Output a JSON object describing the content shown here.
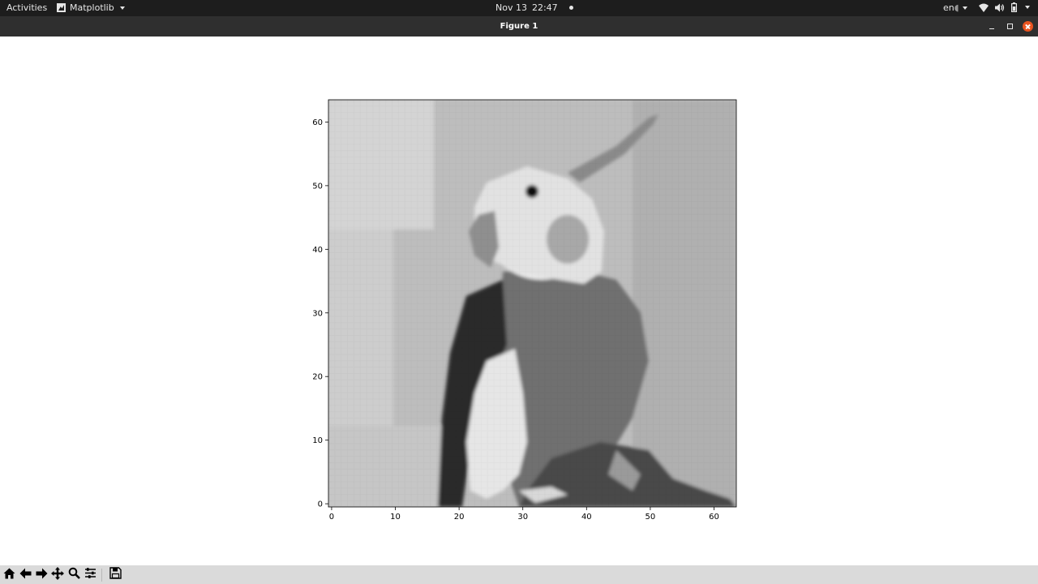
{
  "topbar": {
    "activities": "Activities",
    "app_name": "Matplotlib",
    "date": "Nov 13",
    "time": "22:47",
    "language": "en",
    "icons": [
      "wifi-icon",
      "volume-icon",
      "battery-icon",
      "power-menu-caret"
    ]
  },
  "window": {
    "title": "Figure 1",
    "controls": [
      "minimize",
      "maximize",
      "close"
    ],
    "close_color": "#e95420"
  },
  "toolbar": {
    "buttons": [
      "home-icon",
      "back-icon",
      "forward-icon",
      "pan-icon",
      "zoom-icon",
      "configure-subplots-icon",
      "save-icon"
    ]
  },
  "chart_data": {
    "type": "heatmap",
    "description_hint": "grayscale image (imshow) of a cockatiel, 64x64 pixels",
    "colormap": "gray",
    "x_ticks": [
      "0",
      "10",
      "20",
      "30",
      "40",
      "50",
      "60"
    ],
    "y_ticks": [
      "0",
      "10",
      "20",
      "30",
      "40",
      "50",
      "60"
    ],
    "xlim": [
      -0.5,
      63.5
    ],
    "ylim": [
      63.5,
      -0.5
    ],
    "grid": false,
    "title": "",
    "xlabel": "",
    "ylabel": ""
  }
}
